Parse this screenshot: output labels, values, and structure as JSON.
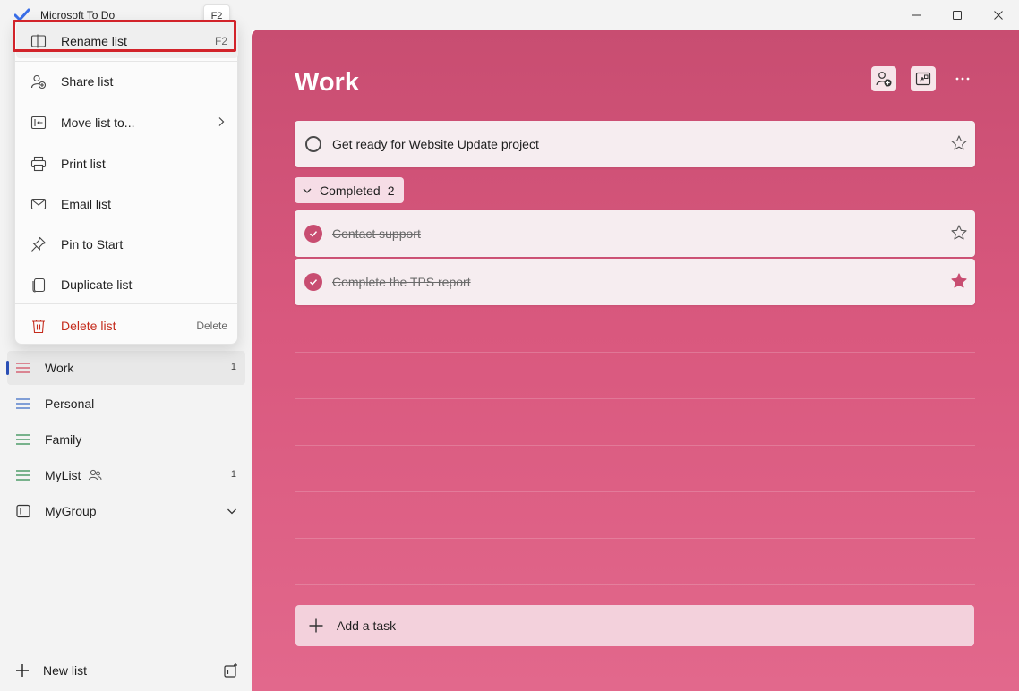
{
  "window": {
    "app_title": "Microsoft To Do",
    "shortcut_tip": "F2"
  },
  "sidebar": {
    "lists": [
      {
        "label": "Work",
        "count": "1",
        "active": true
      },
      {
        "label": "Personal"
      },
      {
        "label": "Family"
      },
      {
        "label": "MyList",
        "count": "1",
        "shared": true
      },
      {
        "label": "MyGroup",
        "group": true
      }
    ],
    "new_list_label": "New list"
  },
  "context_menu": {
    "items": [
      {
        "label": "Rename list",
        "shortcut": "F2",
        "icon": "rename-icon"
      },
      {
        "label": "Share list",
        "icon": "share-person-icon"
      },
      {
        "label": "Move list to...",
        "icon": "move-icon",
        "submenu": true
      },
      {
        "label": "Print list",
        "icon": "printer-icon"
      },
      {
        "label": "Email list",
        "icon": "mail-icon"
      },
      {
        "label": "Pin to Start",
        "icon": "pin-icon"
      },
      {
        "label": "Duplicate list",
        "icon": "duplicate-icon"
      },
      {
        "label": "Delete list",
        "shortcut": "Delete",
        "icon": "trash-icon",
        "danger": true
      }
    ]
  },
  "main": {
    "title": "Work",
    "tasks": [
      {
        "label": "Get ready for Website Update project",
        "completed": false,
        "important": false
      }
    ],
    "completed_section": {
      "label": "Completed",
      "count": "2",
      "tasks": [
        {
          "label": "Contact support",
          "completed": true,
          "important": false
        },
        {
          "label": "Complete the TPS report",
          "completed": true,
          "important": true
        }
      ]
    },
    "add_task_label": "Add a task"
  },
  "colors": {
    "accent": "#c84d71",
    "danger": "#c42b1c",
    "highlight_frame": "#d2232a"
  }
}
